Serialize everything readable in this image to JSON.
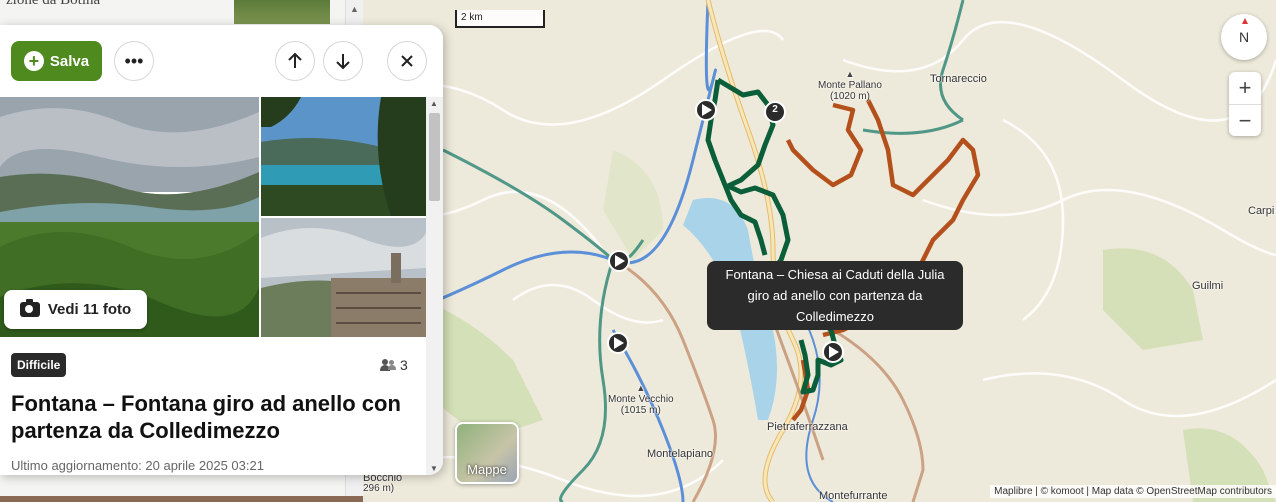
{
  "background_page": {
    "peek_text": "zione da Botina"
  },
  "panel": {
    "save_label": "Salva",
    "more_icon": "more-dots-icon",
    "prev_icon": "arrow-up-icon",
    "next_icon": "arrow-down-icon",
    "close_icon": "close-icon",
    "photos_button_label": "Vedi 11 foto",
    "difficulty": "Difficile",
    "participants": "3",
    "title": "Fontana – Fontana giro ad anello con partenza da Colledimezzo",
    "updated": "Ultimo aggiornamento: 20 aprile 2025 03:21"
  },
  "map": {
    "scale_label": "2 km",
    "compass_label": "N",
    "zoom_in": "+",
    "zoom_out": "−",
    "tooltip": "Fontana – Chiesa ai Caduti della Julia giro ad anello con partenza da Colledimezzo",
    "cluster_count": "2",
    "layers_label": "Mappe",
    "attribution": "Maplibre | © komoot | Map data © OpenStreetMap contributors",
    "places": {
      "tornareccio": "Tornareccio",
      "pietraferrazzana": "Pietraferrazzana",
      "montelapiano": "Montelapiano",
      "guilmi": "Guilmi",
      "carpi": "Carpi",
      "montefurrante": "Montefurrante",
      "bocchio": "Bocchio"
    },
    "peaks": {
      "pallano_name": "Monte Pallano",
      "pallano_elev": "(1020 m)",
      "vecchio_name": "Monte Vecchio",
      "vecchio_elev": "(1015 m)",
      "bocchio_elev": "296 m)"
    },
    "colors": {
      "route_green": "#0b5e3a",
      "route_brown": "#b4501b",
      "route_light": "#c89a7a",
      "lake": "#a9d3e8",
      "river": "#4a82d0"
    }
  }
}
